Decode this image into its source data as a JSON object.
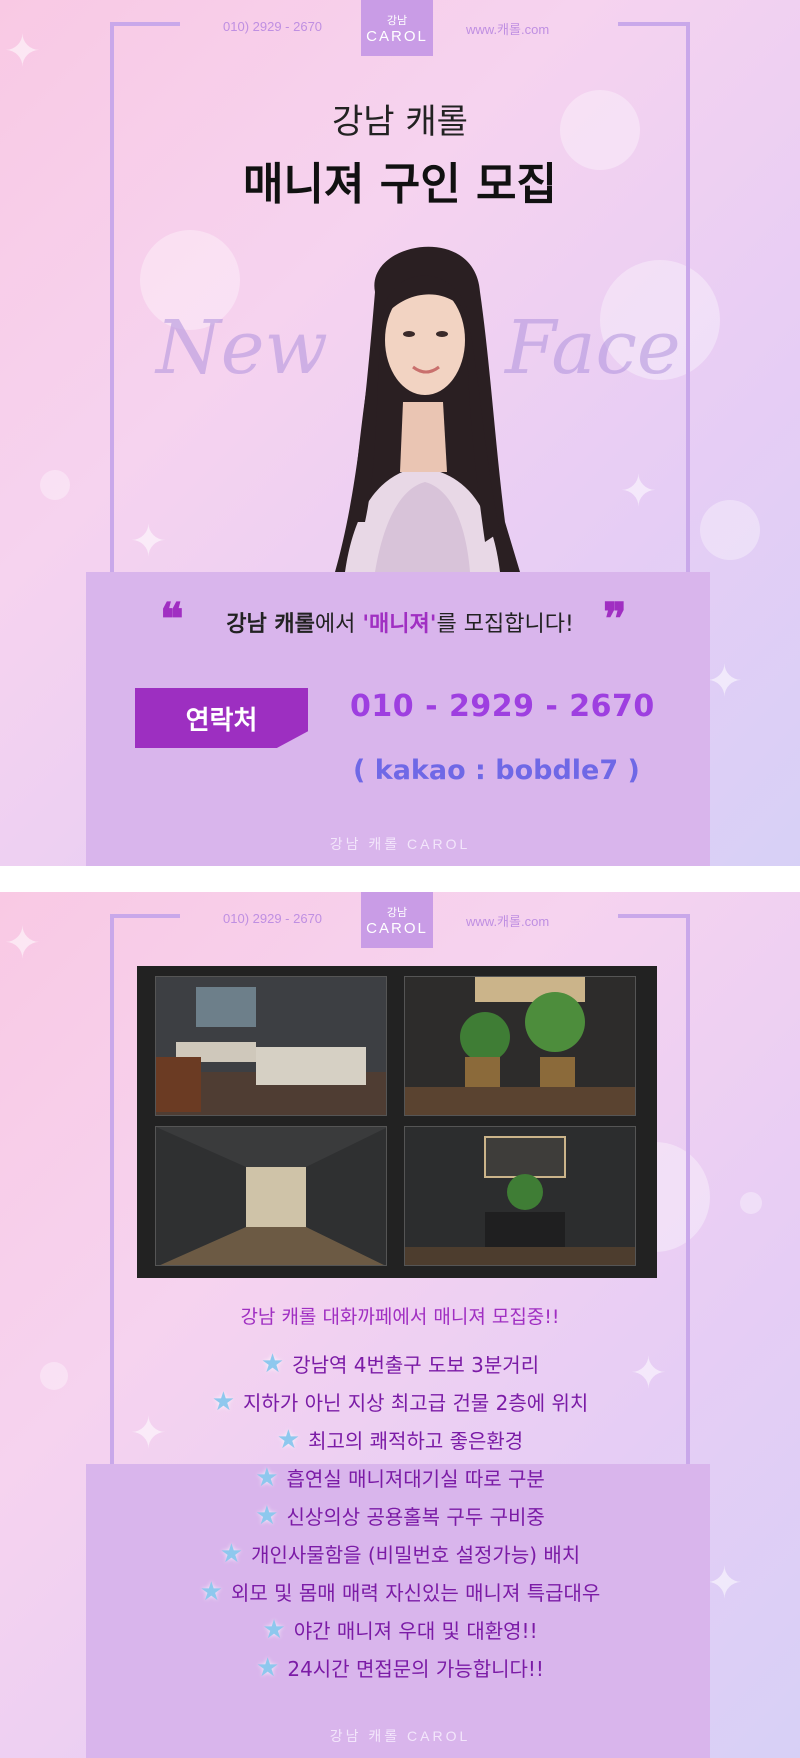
{
  "header": {
    "phone": "010) 2929 - 2670",
    "website": "www.캐롤.com",
    "logo_ko": "강남",
    "logo_en": "CAROL"
  },
  "hero": {
    "subtitle": "강남 캐롤",
    "title": "매니져 구인 모집",
    "script_left": "New",
    "script_right": "Face"
  },
  "recruit": {
    "part1": "강남 캐롤",
    "part2": "에서 ",
    "part3": "'매니져'",
    "part4": "를 모집합니다!",
    "quote_open": "❝",
    "quote_close": "❞"
  },
  "contact": {
    "label": "연락처",
    "phone": "010 - 2929 - 2670",
    "kakao": "( kakao : bobdle7 )"
  },
  "footer": {
    "brand": "강남 캐롤 CAROL"
  },
  "cafe": {
    "title": "강남 캐롤 대화까페에서 매니져 모집중!!",
    "features": [
      "강남역 4번출구 도보 3분거리",
      "지하가 아닌 지상 최고급 건물 2층에 위치",
      "최고의 쾌적하고 좋은환경",
      "흡연실 매니져대기실 따로 구분",
      "신상의상 공용홀복 구두 구비중",
      "개인사물함을 (비밀번호 설정가능) 배치",
      "외모 및 몸매 매력 자신있는 매니져 특급대우",
      "야간 매니져 우대 및 대환영!!",
      "24시간 면접문의 가능합니다!!"
    ]
  },
  "colors": {
    "accent_purple": "#9d2fc1",
    "panel_lilac": "#d9b5ec",
    "frame_line": "#c9a8ea",
    "star_blue": "#8ec8ee"
  }
}
